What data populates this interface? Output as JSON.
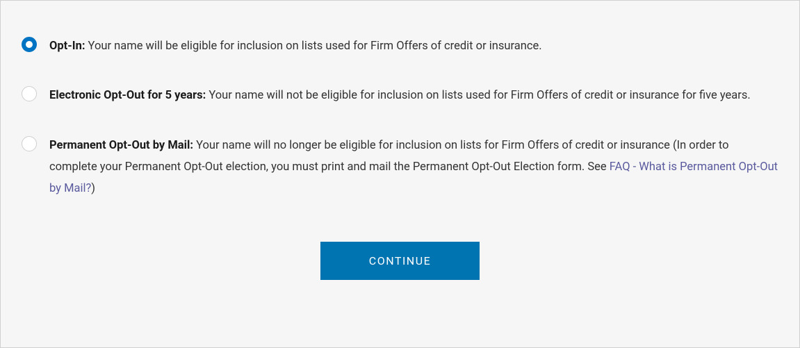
{
  "options": [
    {
      "title": "Opt-In:",
      "description": " Your name will be eligible for inclusion on lists used for Firm Offers of credit or insurance.",
      "selected": true
    },
    {
      "title": "Electronic Opt-Out for 5 years:",
      "description": " Your name will not be eligible for inclusion on lists used for Firm Offers of credit or insurance for five years.",
      "selected": false
    },
    {
      "title": "Permanent Opt-Out by Mail:",
      "description_prefix": " Your name will no longer be eligible for inclusion on lists for Firm Offers of credit or insurance (In order to complete your Permanent Opt-Out election, you must print and mail the Permanent Opt-Out Election form. See ",
      "link_text": "FAQ - What is Permanent Opt-Out by Mail?",
      "description_suffix": ")",
      "selected": false
    }
  ],
  "button": {
    "continue_label": "CONTINUE"
  }
}
